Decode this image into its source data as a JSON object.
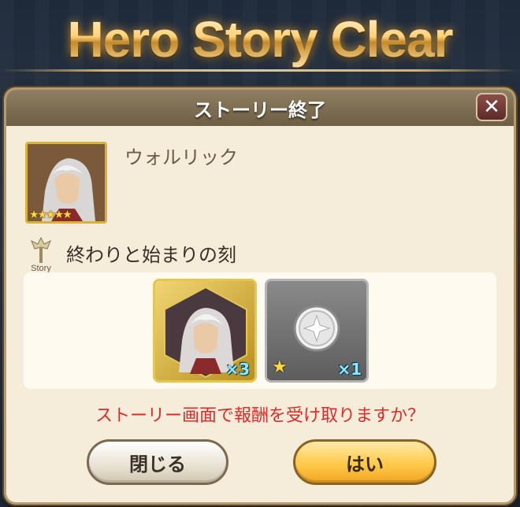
{
  "banner": {
    "title": "Hero Story Clear"
  },
  "dialog": {
    "title": "ストーリー終了",
    "close_symbol": "✕",
    "hero": {
      "name": "ウォルリック",
      "rarity_stars": "★★★★★",
      "portrait_icon": "hero-portrait"
    },
    "story": {
      "icon_label": "Story",
      "title": "終わりと始まりの刻"
    },
    "rewards": [
      {
        "type": "hero-memory",
        "quantity": "×3"
      },
      {
        "type": "medal",
        "quantity": "×1",
        "star": "★"
      }
    ],
    "question": "ストーリー画面で報酬を受け取りますか？",
    "buttons": {
      "close_label": "閉じる",
      "yes_label": "はい"
    }
  },
  "colors": {
    "question_red": "#e02a2a",
    "gold": "#ffc94a",
    "header": "#6d5e44",
    "panel": "#f5ecd9"
  }
}
